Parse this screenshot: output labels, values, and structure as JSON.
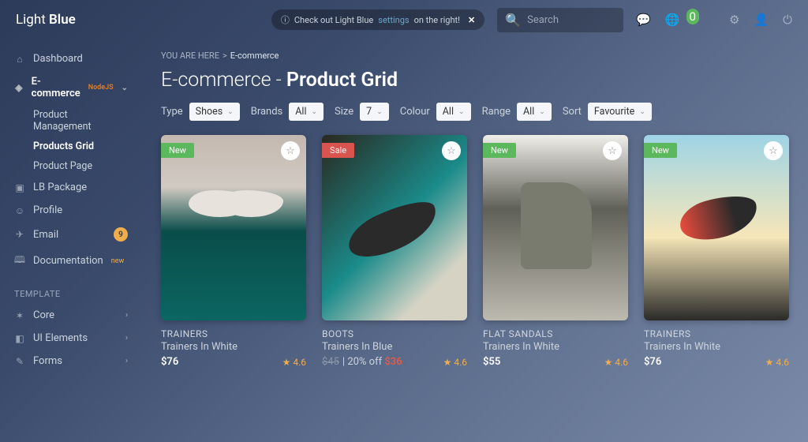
{
  "logo": {
    "light": "Light",
    "bold": "Blue"
  },
  "notif": {
    "pre": "Check out Light Blue",
    "link": "settings",
    "post": "on the right!"
  },
  "search": {
    "placeholder": "Search"
  },
  "topbar_badge": "0",
  "sidebar": {
    "items": [
      {
        "icon": "⌂",
        "label": "Dashboard"
      },
      {
        "icon": "◈",
        "label": "E-commerce",
        "sup": "NodeJS",
        "chev": true,
        "active": true,
        "sub": [
          {
            "label": "Product Management"
          },
          {
            "label": "Products Grid",
            "active": true
          },
          {
            "label": "Product Page"
          }
        ]
      },
      {
        "icon": "▣",
        "label": "LB Package"
      },
      {
        "icon": "☺",
        "label": "Profile"
      },
      {
        "icon": "✈",
        "label": "Email",
        "count": "9"
      },
      {
        "icon": "🕮",
        "label": "Documentation",
        "sup": "new"
      }
    ],
    "template_header": "TEMPLATE",
    "template_items": [
      {
        "icon": "✶",
        "label": "Core",
        "chev": true
      },
      {
        "icon": "◧",
        "label": "UI Elements",
        "chev": true
      },
      {
        "icon": "✎",
        "label": "Forms",
        "chev": true
      }
    ]
  },
  "breadcrumb": {
    "here": "YOU ARE HERE",
    "cur": "E-commerce"
  },
  "title": {
    "a": "E-commerce - ",
    "b": "Product Grid"
  },
  "filters": [
    {
      "label": "Type",
      "value": "Shoes"
    },
    {
      "label": "Brands",
      "value": "All"
    },
    {
      "label": "Size",
      "value": "7"
    },
    {
      "label": "Colour",
      "value": "All"
    },
    {
      "label": "Range",
      "value": "All"
    },
    {
      "label": "Sort",
      "value": "Favourite"
    }
  ],
  "products": [
    {
      "tag": "New",
      "tagClass": "new",
      "category": "TRAINERS",
      "name": "Trainers In White",
      "price": "$76",
      "rating": "4.6",
      "img": "img1"
    },
    {
      "tag": "Sale",
      "tagClass": "sale",
      "category": "BOOTS",
      "name": "Trainers In Blue",
      "strike": "$45",
      "off": "| 20% off",
      "salePrice": "$36",
      "rating": "4.6",
      "img": "img2"
    },
    {
      "tag": "New",
      "tagClass": "new",
      "category": "FLAT SANDALS",
      "name": "Trainers In White",
      "price": "$55",
      "rating": "4.6",
      "img": "img3"
    },
    {
      "tag": "New",
      "tagClass": "new",
      "category": "TRAINERS",
      "name": "Trainers In White",
      "price": "$76",
      "rating": "4.6",
      "img": "img4"
    }
  ]
}
